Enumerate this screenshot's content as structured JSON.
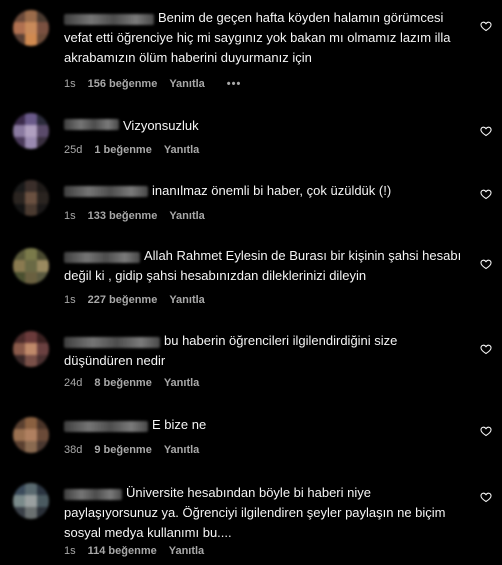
{
  "colors": {
    "background": "#000000",
    "text": "#f5f5f5",
    "meta": "#a8a8a8"
  },
  "comments": [
    {
      "text": "Benim de geçen hafta köyden halamın görümcesi vefat etti öğrenciye hiç mi saygınız yok bakan mı olmamız lazım illa akrabamızın ölüm haberini duyurmanız için",
      "time": "1s",
      "likes": "156 beğenme",
      "reply": "Yanıtla",
      "more": "•••",
      "avatar": [
        "#6b4a3a",
        "#9a6b4a",
        "#4a3a30",
        "#b07050",
        "#c98a5a",
        "#7a5040",
        "#5a4035",
        "#d08a50",
        "#6a4a38"
      ]
    },
    {
      "text": "Vizyonsuzluk",
      "time": "25d",
      "likes": "1 beğenme",
      "reply": "Yanıtla",
      "avatar": [
        "#3a2a4a",
        "#6a5a8a",
        "#2a2a3a",
        "#8a7aa0",
        "#b0a0c0",
        "#5a4a6a",
        "#4a3a5a",
        "#9a8ab0",
        "#3a3040"
      ]
    },
    {
      "text": "inanılmaz önemli bi haber, çok üzüldük (!)",
      "time": "1s",
      "likes": "133 beğenme",
      "reply": "Yanıtla",
      "avatar": [
        "#1a1a1a",
        "#3a2e2a",
        "#1e1a18",
        "#2a2420",
        "#6a5040",
        "#2a2420",
        "#141414",
        "#4a3a30",
        "#1a1818"
      ]
    },
    {
      "text": "Allah Rahmet Eylesin de Burası bir kişinin şahsi hesabı değil ki , gidip şahsi hesabınızdan dileklerinizi dileyin",
      "time": "1s",
      "likes": "227 beğenme",
      "reply": "Yanıtla",
      "avatar": [
        "#5a5a3a",
        "#7a7a4a",
        "#4a4a30",
        "#8a7a50",
        "#6a6a45",
        "#9a8a60",
        "#4a5030",
        "#6a6040",
        "#5a5a40"
      ]
    },
    {
      "text": "bu haberin öğrencileri ilgilendirdiğini size düşündüren nedir",
      "time": "24d",
      "likes": "8 beğenme",
      "reply": "Yanıtla",
      "avatar": [
        "#4a2a2a",
        "#6a3a3a",
        "#3a2020",
        "#8a5a4a",
        "#c08a6a",
        "#6a4040",
        "#3a2828",
        "#7a5048",
        "#4a3030"
      ]
    },
    {
      "text": "E bize ne",
      "time": "38d",
      "likes": "9 beğenme",
      "reply": "Yanıtla",
      "avatar": [
        "#5a4030",
        "#8a6040",
        "#4a3428",
        "#9a7050",
        "#b08060",
        "#6a4a38",
        "#5a4030",
        "#8a6a50",
        "#4a3830"
      ]
    },
    {
      "text": "Üniversite hesabından böyle bi haberi niye paylaşıyorsunuz ya. Öğrenciyi ilgilendiren şeyler paylaşın ne biçim sosyal medya kullanımı bu....",
      "time": "1s",
      "likes": "114 beğenme",
      "reply": "Yanıtla",
      "avatar": [
        "#3a4a5a",
        "#5a6a70",
        "#2a3440",
        "#7a8a8a",
        "#9aa0a0",
        "#4a5a60",
        "#3a4048",
        "#6a7070",
        "#2a3038"
      ]
    }
  ]
}
